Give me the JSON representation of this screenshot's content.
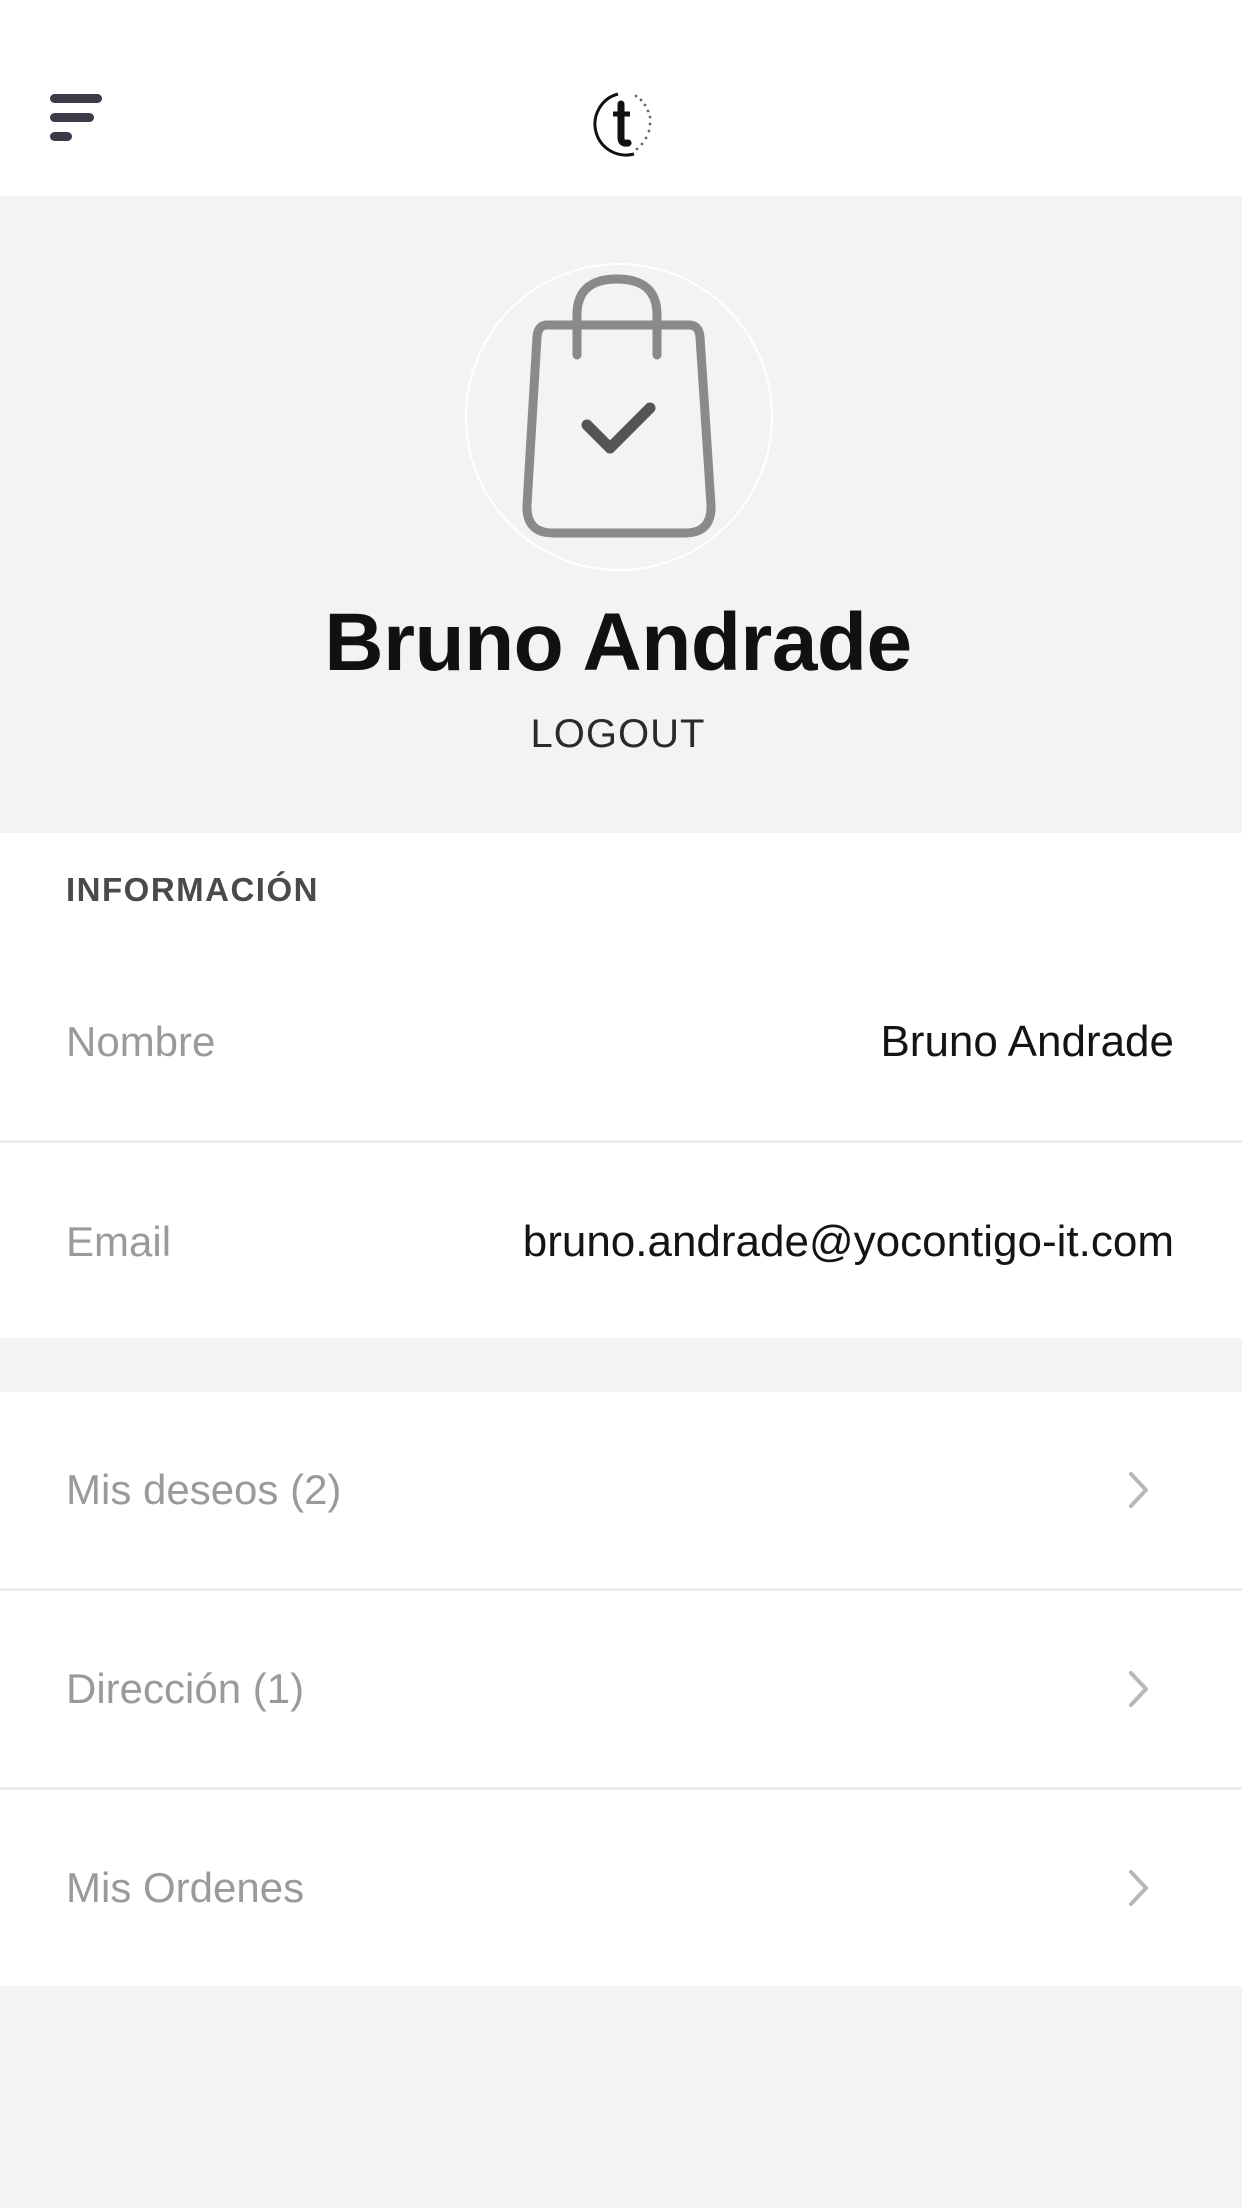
{
  "header": {
    "menu_icon": "menu-icon",
    "logo_icon": "brand-logo-icon"
  },
  "profile": {
    "avatar_icon": "shopping-bag-check-icon",
    "name": "Bruno Andrade",
    "logout_label": "LOGOUT"
  },
  "info": {
    "section_title": "INFORMACIÓN",
    "rows": [
      {
        "label": "Nombre",
        "value": "Bruno Andrade"
      },
      {
        "label": "Email",
        "value": "bruno.andrade@yocontigo-it.com"
      }
    ]
  },
  "links": [
    {
      "label": "Mis deseos (2)",
      "icon": "chevron-right-icon"
    },
    {
      "label": "Dirección (1)",
      "icon": "chevron-right-icon"
    },
    {
      "label": "Mis Ordenes",
      "icon": "chevron-right-icon"
    }
  ],
  "colors": {
    "background": "#f3f3f3",
    "card": "#ffffff",
    "text_dark": "#111111",
    "text_muted": "#9a9a9a",
    "icon_gray": "#8a8a8a"
  }
}
